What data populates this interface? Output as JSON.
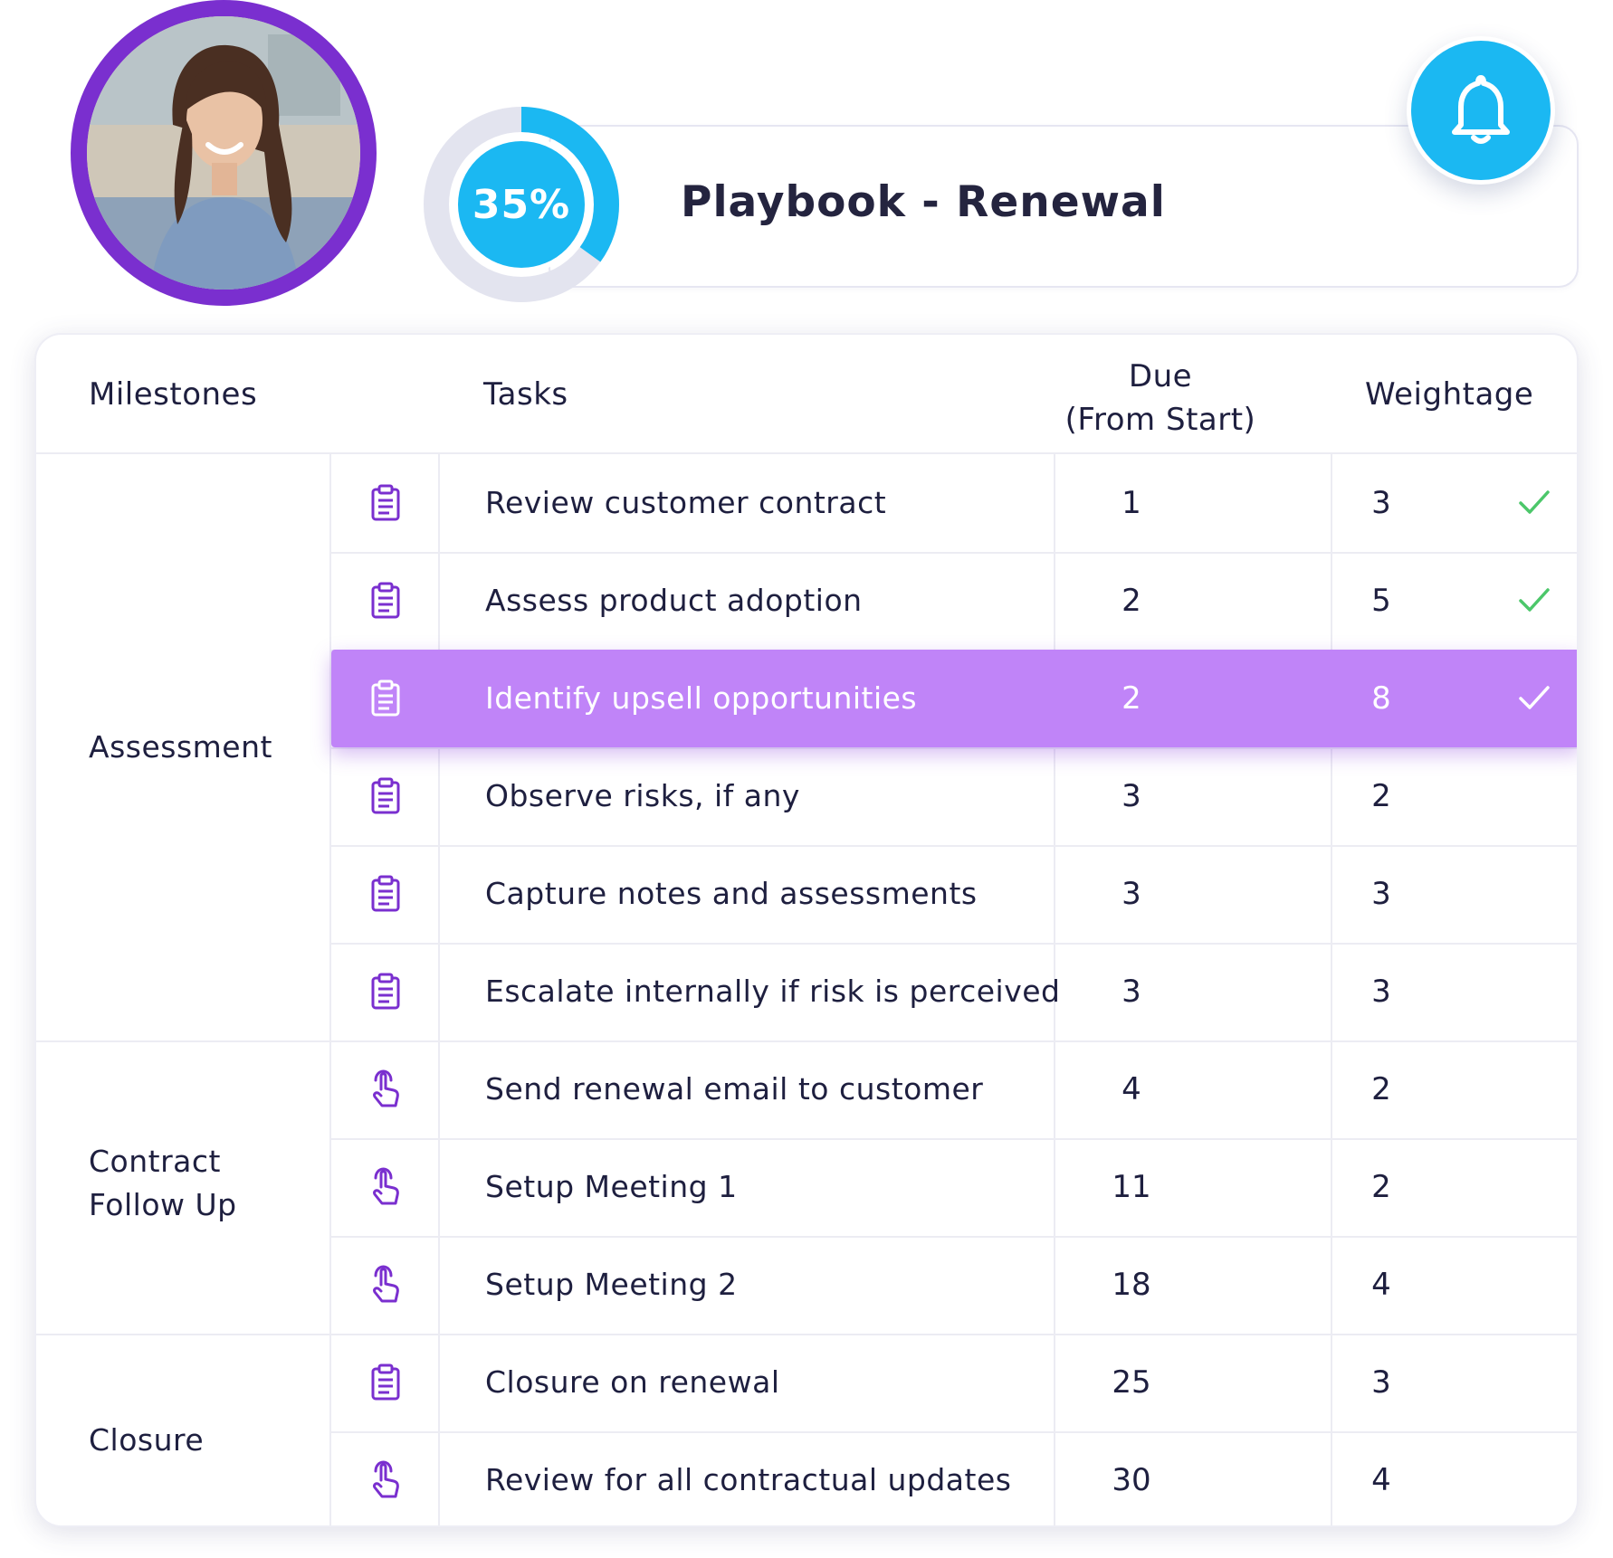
{
  "header": {
    "title": "Playbook - Renewal",
    "progress": {
      "value": 0.35,
      "label": "35%"
    }
  },
  "table": {
    "columns": {
      "milestones": "Milestones",
      "tasks": "Tasks",
      "due_line1": "Due",
      "due_line2": "(From Start)",
      "weightage": "Weightage"
    },
    "milestones": {
      "assessment": "Assessment",
      "contract_line1": "Contract",
      "contract_line2": "Follow Up",
      "closure": "Closure"
    },
    "rows": [
      {
        "icon": "clipboard-icon",
        "task": "Review customer contract",
        "due": "1",
        "weight": "3",
        "done": true
      },
      {
        "icon": "clipboard-icon",
        "task": "Assess product adoption",
        "due": "2",
        "weight": "5",
        "done": true
      },
      {
        "icon": "clipboard-icon",
        "task": "Identify upsell opportunities",
        "due": "2",
        "weight": "8",
        "done": true
      },
      {
        "icon": "clipboard-icon",
        "task": "Observe risks, if any",
        "due": "3",
        "weight": "2",
        "done": false
      },
      {
        "icon": "clipboard-icon",
        "task": "Capture notes and assessments",
        "due": "3",
        "weight": "3",
        "done": false
      },
      {
        "icon": "clipboard-icon",
        "task": "Escalate internally if risk is perceived",
        "due": "3",
        "weight": "3",
        "done": false
      },
      {
        "icon": "pointer-hand-icon",
        "task": "Send renewal email to customer",
        "due": "4",
        "weight": "2",
        "done": false
      },
      {
        "icon": "pointer-hand-icon",
        "task": "Setup Meeting 1",
        "due": "11",
        "weight": "2",
        "done": false
      },
      {
        "icon": "pointer-hand-icon",
        "task": "Setup Meeting 2",
        "due": "18",
        "weight": "4",
        "done": false
      },
      {
        "icon": "clipboard-icon",
        "task": "Closure on renewal",
        "due": "25",
        "weight": "3",
        "done": false
      },
      {
        "icon": "pointer-hand-icon",
        "task": "Review for all contractual updates",
        "due": "30",
        "weight": "4",
        "done": false
      }
    ]
  },
  "colors": {
    "accent_purple": "#7a2fcf",
    "highlight_row": "#c084f8",
    "progress_blue": "#1bb8f2",
    "progress_track": "#e3e4ef",
    "check_green": "#4cc76a"
  }
}
